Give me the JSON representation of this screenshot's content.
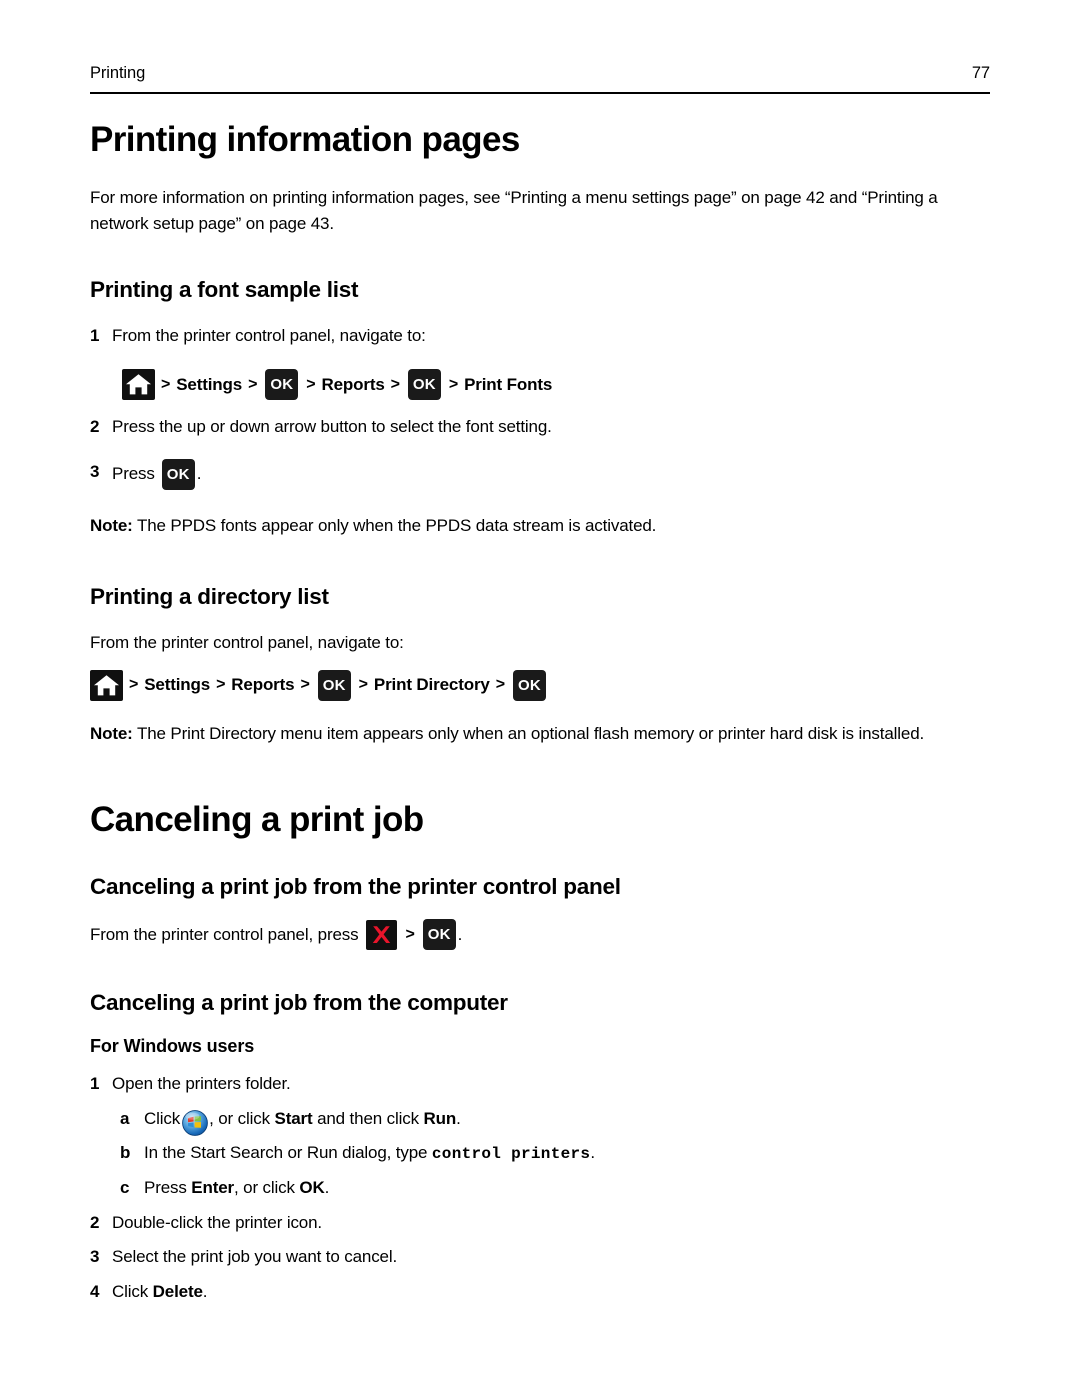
{
  "header": {
    "chapter_label": "Printing",
    "page_number": "77"
  },
  "colors": {
    "chip_background": "#1a1a1a",
    "stop_red": "#e8152b",
    "text": "#000000",
    "page_background": "#ffffff"
  },
  "sections": {
    "printing_information_pages": {
      "title": "Printing information pages",
      "intro": "For more information on printing information pages, see “Printing a menu settings page” on page 42 and “Printing a network setup page” on page 43."
    },
    "font_sample_list": {
      "title": "Printing a font sample list",
      "steps": [
        {
          "num": "1",
          "text": "From the printer control panel, navigate to:"
        },
        {
          "num": "2",
          "text": "Press the up or down arrow button to select the font setting."
        }
      ],
      "path": {
        "home_icon": "home-icon",
        "segments": [
          {
            "type": "sep",
            "label": ">"
          },
          {
            "type": "text",
            "label": "Settings"
          },
          {
            "type": "sep",
            "label": ">"
          },
          {
            "type": "chip",
            "label": "OK"
          },
          {
            "type": "sep",
            "label": ">"
          },
          {
            "type": "text",
            "label": "Reports"
          },
          {
            "type": "sep",
            "label": ">"
          },
          {
            "type": "chip",
            "label": "OK"
          },
          {
            "type": "sep",
            "label": ">"
          },
          {
            "type": "text",
            "label": "Print Fonts"
          }
        ]
      },
      "step3": {
        "num": "3",
        "prefix": "Press",
        "chip": "OK",
        "suffix": "."
      },
      "note_label": "Note:",
      "note_text": "The PPDS fonts appear only when the PPDS data stream is activated."
    },
    "directory_list": {
      "title": "Printing a directory list",
      "intro": "From the printer control panel, navigate to:",
      "path": {
        "home_icon": "home-icon",
        "segments": [
          {
            "type": "sep",
            "label": ">"
          },
          {
            "type": "text",
            "label": "Settings"
          },
          {
            "type": "sep",
            "label": ">"
          },
          {
            "type": "text",
            "label": "Reports"
          },
          {
            "type": "sep",
            "label": ">"
          },
          {
            "type": "chip",
            "label": "OK"
          },
          {
            "type": "sep",
            "label": ">"
          },
          {
            "type": "text",
            "label": "Print Directory"
          },
          {
            "type": "sep",
            "label": ">"
          },
          {
            "type": "chip",
            "label": "OK"
          }
        ]
      },
      "note_label": "Note:",
      "note_text": "The Print Directory menu item appears only when an optional flash memory or printer hard disk is installed."
    },
    "canceling_print_job": {
      "title": "Canceling a print job",
      "from_control_panel": {
        "title": "Canceling a print job from the printer control panel",
        "line_prefix": "From the printer control panel, press",
        "stop_icon": "stop-icon",
        "separator": ">",
        "ok_chip": "OK",
        "line_suffix": "."
      },
      "from_computer": {
        "title": "Canceling a print job from the computer",
        "windows_heading": "For Windows users",
        "steps": [
          {
            "num": "1",
            "text": "Open the printers folder."
          },
          {
            "num": "2",
            "text": "Double-click the printer icon."
          },
          {
            "num": "3",
            "text": "Select the print job you want to cancel."
          }
        ],
        "substeps": [
          {
            "letter": "a",
            "prefix": "Click",
            "icon": "windows-start-orb-icon",
            "middle": ", or click ",
            "bold1": "Start",
            "middle2": " and then click ",
            "bold2": "Run",
            "suffix": "."
          },
          {
            "letter": "b",
            "prefix": "In the Start Search or Run dialog, type ",
            "mono": "control printers",
            "suffix": "."
          },
          {
            "letter": "c",
            "prefix": "Press ",
            "bold1": "Enter",
            "middle": ", or click ",
            "bold2": "OK",
            "suffix": "."
          }
        ],
        "final_step": {
          "num": "4",
          "prefix": "Click ",
          "bold": "Delete",
          "suffix": "."
        }
      }
    }
  }
}
